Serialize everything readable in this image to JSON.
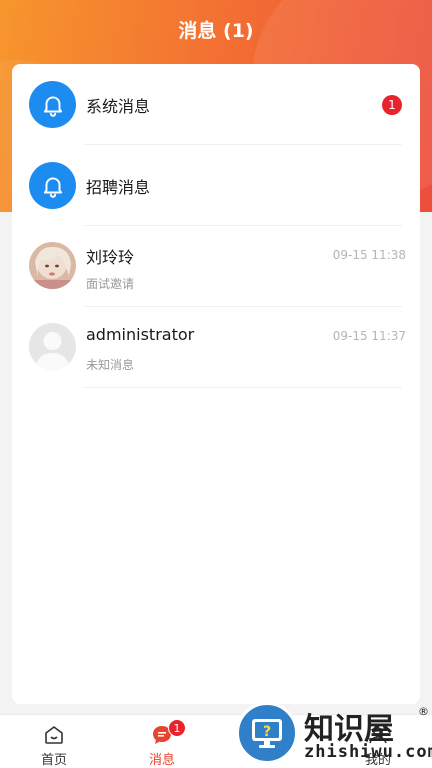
{
  "header": {
    "title": "消息 (1)"
  },
  "messages": [
    {
      "title": "系统消息",
      "badge": "1",
      "icon": "bell-icon"
    },
    {
      "title": "招聘消息",
      "icon": "bell-icon"
    },
    {
      "title": "刘玲玲",
      "subtitle": "面试邀请",
      "time": "09-15 11:38",
      "icon": "user-avatar-photo"
    },
    {
      "title": "administrator",
      "subtitle": "未知消息",
      "time": "09-15 11:37",
      "icon": "default-avatar"
    }
  ],
  "tabbar": {
    "items": [
      {
        "label": "首页",
        "icon": "home-icon"
      },
      {
        "label": "消息",
        "icon": "message-icon",
        "badge": "1"
      },
      {
        "label": "",
        "icon": ""
      },
      {
        "label": "我的",
        "icon": "profile-icon"
      }
    ],
    "active_color": "#e8432e"
  },
  "watermark": {
    "brand": "知识屋",
    "reg": "®",
    "domain": "zhishiwu.com"
  },
  "colors": {
    "accent": "#1d8cf0",
    "badge": "#e8232b",
    "header_start": "#f7962d",
    "header_end": "#ec4f3c"
  }
}
